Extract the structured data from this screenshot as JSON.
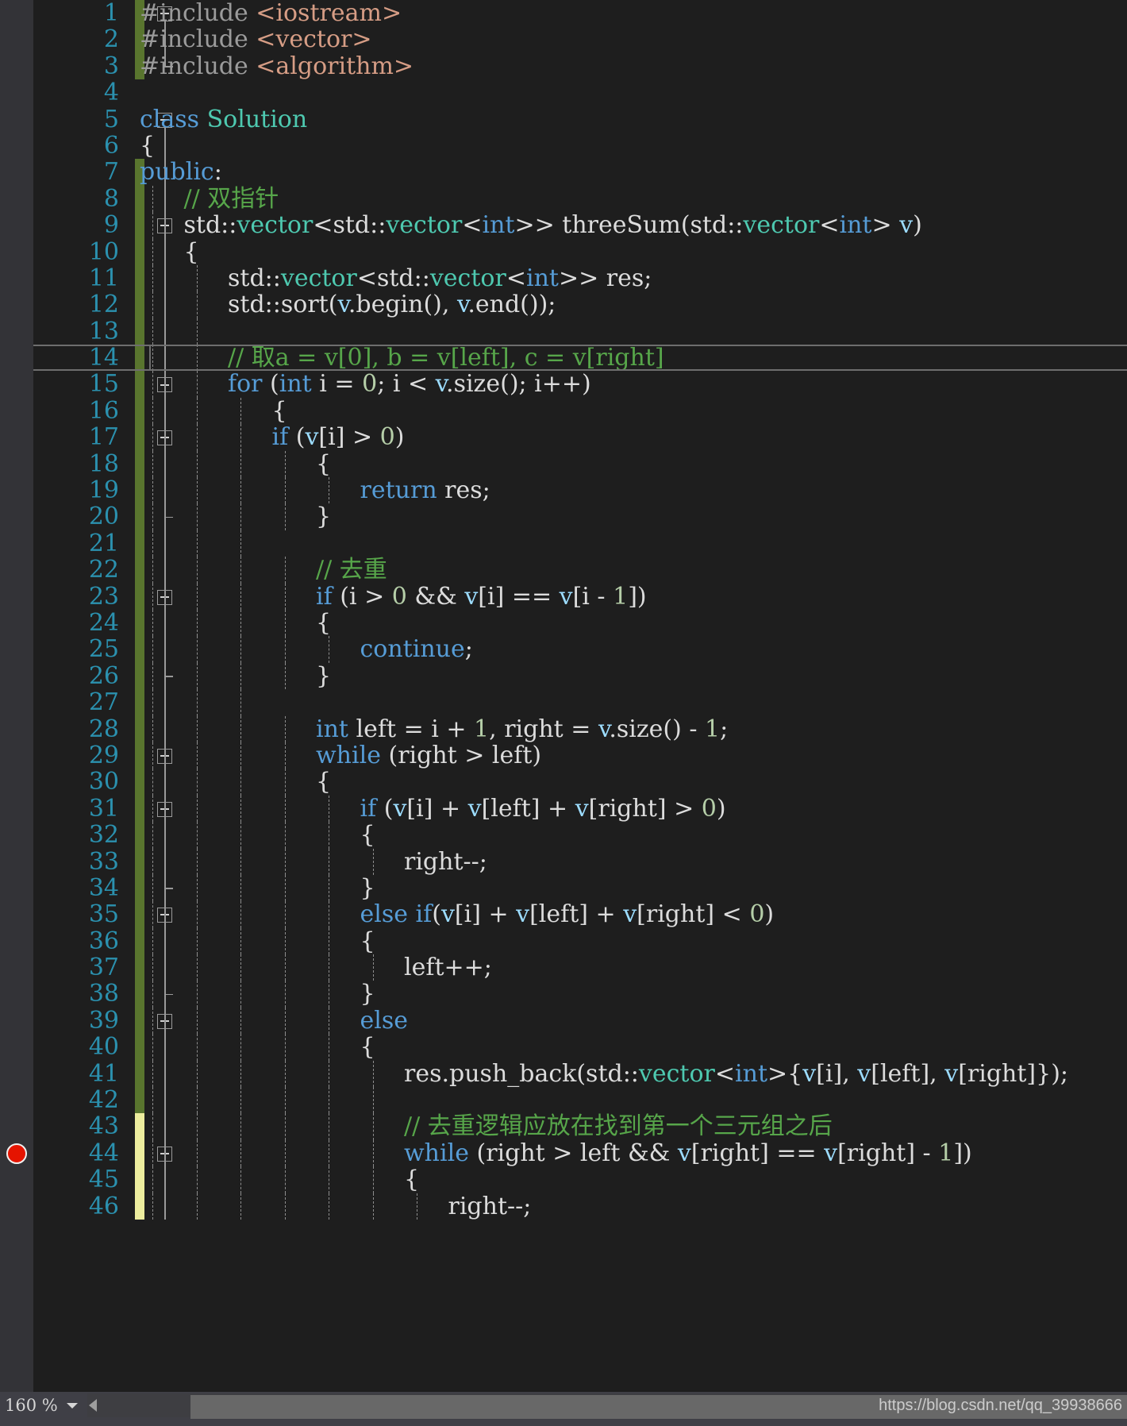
{
  "editor": {
    "language": "cpp",
    "theme": "visual-studio-dark",
    "breakpoint_line": 44,
    "current_line": 14,
    "first_visible_line": 1,
    "last_visible_line": 46,
    "colors": {
      "background": "#1e1e1e",
      "gutter": "#333337",
      "line_number": "#2b91af",
      "keyword": "#569cd6",
      "type": "#4ec9b0",
      "comment": "#57a64a",
      "string": "#d69d85",
      "number": "#b5cea8",
      "local_variable": "#9cdcfe",
      "plain_text": "#dcdcdc",
      "change_bar_saved": "#59752e",
      "change_bar_unsaved": "#eded9e",
      "breakpoint": "#e51400",
      "status_bar": "#3f3f46"
    },
    "lines": [
      {
        "n": 1,
        "change": "green",
        "fold": "start",
        "guides": 0,
        "indent": 0,
        "tokens": [
          {
            "t": "#include ",
            "c": "t-pre"
          },
          {
            "t": "<iostream>",
            "c": "t-str"
          }
        ]
      },
      {
        "n": 2,
        "change": "green",
        "fold": "line",
        "guides": 0,
        "indent": 0,
        "tokens": [
          {
            "t": "#include ",
            "c": "t-pre"
          },
          {
            "t": "<vector>",
            "c": "t-str"
          }
        ]
      },
      {
        "n": 3,
        "change": "green",
        "fold": "end",
        "guides": 0,
        "indent": 0,
        "tokens": [
          {
            "t": "#include ",
            "c": "t-pre"
          },
          {
            "t": "<algorithm>",
            "c": "t-str"
          }
        ]
      },
      {
        "n": 4,
        "change": "none",
        "fold": "none",
        "guides": 0,
        "indent": 0,
        "tokens": []
      },
      {
        "n": 5,
        "change": "none",
        "fold": "start",
        "guides": 0,
        "indent": 0,
        "tokens": [
          {
            "t": "class ",
            "c": "t-kw"
          },
          {
            "t": "Solution",
            "c": "t-type"
          }
        ]
      },
      {
        "n": 6,
        "change": "none",
        "fold": "line",
        "guides": 0,
        "indent": 0,
        "tokens": [
          {
            "t": "{",
            "c": "t-punct"
          }
        ]
      },
      {
        "n": 7,
        "change": "green",
        "fold": "line",
        "guides": 0,
        "indent": 0,
        "tokens": [
          {
            "t": "public",
            "c": "t-kw"
          },
          {
            "t": ":",
            "c": "t-punct"
          }
        ]
      },
      {
        "n": 8,
        "change": "green",
        "fold": "line",
        "guides": 1,
        "indent": 1,
        "tokens": [
          {
            "t": "// 双指针",
            "c": "t-cmt"
          }
        ]
      },
      {
        "n": 9,
        "change": "green",
        "fold": "start2",
        "guides": 1,
        "indent": 1,
        "tokens": [
          {
            "t": "std",
            "c": "t-plain"
          },
          {
            "t": "::",
            "c": "t-punct"
          },
          {
            "t": "vector",
            "c": "t-type"
          },
          {
            "t": "<",
            "c": "t-punct"
          },
          {
            "t": "std",
            "c": "t-plain"
          },
          {
            "t": "::",
            "c": "t-punct"
          },
          {
            "t": "vector",
            "c": "t-type"
          },
          {
            "t": "<",
            "c": "t-punct"
          },
          {
            "t": "int",
            "c": "t-kw"
          },
          {
            "t": ">> ",
            "c": "t-punct"
          },
          {
            "t": "threeSum",
            "c": "t-plain"
          },
          {
            "t": "(",
            "c": "t-punct"
          },
          {
            "t": "std",
            "c": "t-plain"
          },
          {
            "t": "::",
            "c": "t-punct"
          },
          {
            "t": "vector",
            "c": "t-type"
          },
          {
            "t": "<",
            "c": "t-punct"
          },
          {
            "t": "int",
            "c": "t-kw"
          },
          {
            "t": "> ",
            "c": "t-punct"
          },
          {
            "t": "v",
            "c": "t-var"
          },
          {
            "t": ")",
            "c": "t-punct"
          }
        ]
      },
      {
        "n": 10,
        "change": "green",
        "fold": "line2",
        "guides": 1,
        "indent": 1,
        "tokens": [
          {
            "t": "{",
            "c": "t-punct"
          }
        ]
      },
      {
        "n": 11,
        "change": "green",
        "fold": "line2",
        "guides": 2,
        "indent": 2,
        "tokens": [
          {
            "t": "std",
            "c": "t-plain"
          },
          {
            "t": "::",
            "c": "t-punct"
          },
          {
            "t": "vector",
            "c": "t-type"
          },
          {
            "t": "<",
            "c": "t-punct"
          },
          {
            "t": "std",
            "c": "t-plain"
          },
          {
            "t": "::",
            "c": "t-punct"
          },
          {
            "t": "vector",
            "c": "t-type"
          },
          {
            "t": "<",
            "c": "t-punct"
          },
          {
            "t": "int",
            "c": "t-kw"
          },
          {
            "t": ">> ",
            "c": "t-punct"
          },
          {
            "t": "res",
            "c": "t-plain"
          },
          {
            "t": ";",
            "c": "t-punct"
          }
        ]
      },
      {
        "n": 12,
        "change": "green",
        "fold": "line2",
        "guides": 2,
        "indent": 2,
        "tokens": [
          {
            "t": "std",
            "c": "t-plain"
          },
          {
            "t": "::",
            "c": "t-punct"
          },
          {
            "t": "sort",
            "c": "t-plain"
          },
          {
            "t": "(",
            "c": "t-punct"
          },
          {
            "t": "v",
            "c": "t-var"
          },
          {
            "t": ".begin(), ",
            "c": "t-plain"
          },
          {
            "t": "v",
            "c": "t-var"
          },
          {
            "t": ".end());",
            "c": "t-plain"
          }
        ]
      },
      {
        "n": 13,
        "change": "green",
        "fold": "line2",
        "guides": 2,
        "indent": 2,
        "tokens": []
      },
      {
        "n": 14,
        "change": "green",
        "fold": "line2",
        "guides": 2,
        "indent": 2,
        "tokens": [
          {
            "t": "// 取a = v[0], b = v[left], c = v[right]",
            "c": "t-cmt"
          }
        ]
      },
      {
        "n": 15,
        "change": "green",
        "fold": "start3",
        "guides": 2,
        "indent": 2,
        "tokens": [
          {
            "t": "for ",
            "c": "t-kw"
          },
          {
            "t": "(",
            "c": "t-punct"
          },
          {
            "t": "int",
            "c": "t-kw"
          },
          {
            "t": " i = ",
            "c": "t-plain"
          },
          {
            "t": "0",
            "c": "t-num"
          },
          {
            "t": "; i < ",
            "c": "t-plain"
          },
          {
            "t": "v",
            "c": "t-var"
          },
          {
            "t": ".size(); i++)",
            "c": "t-plain"
          }
        ]
      },
      {
        "n": 16,
        "change": "green",
        "fold": "line3",
        "guides": 3,
        "indent": 3,
        "tokens": [
          {
            "t": "{",
            "c": "t-punct"
          }
        ]
      },
      {
        "n": 17,
        "change": "green",
        "fold": "start4",
        "guides": 3,
        "indent": 3,
        "tokens": [
          {
            "t": "if ",
            "c": "t-kw"
          },
          {
            "t": "(",
            "c": "t-punct"
          },
          {
            "t": "v",
            "c": "t-var"
          },
          {
            "t": "[i] > ",
            "c": "t-plain"
          },
          {
            "t": "0",
            "c": "t-num"
          },
          {
            "t": ")",
            "c": "t-punct"
          }
        ]
      },
      {
        "n": 18,
        "change": "green",
        "fold": "line4",
        "guides": 4,
        "indent": 4,
        "tokens": [
          {
            "t": "{",
            "c": "t-punct"
          }
        ]
      },
      {
        "n": 19,
        "change": "green",
        "fold": "line4",
        "guides": 5,
        "indent": 5,
        "tokens": [
          {
            "t": "return ",
            "c": "t-kw"
          },
          {
            "t": "res;",
            "c": "t-plain"
          }
        ]
      },
      {
        "n": 20,
        "change": "green",
        "fold": "endin4",
        "guides": 4,
        "indent": 4,
        "tokens": [
          {
            "t": "}",
            "c": "t-punct"
          }
        ]
      },
      {
        "n": 21,
        "change": "green",
        "fold": "line3",
        "guides": 3,
        "indent": 3,
        "tokens": []
      },
      {
        "n": 22,
        "change": "green",
        "fold": "line3",
        "guides": 4,
        "indent": 4,
        "tokens": [
          {
            "t": "// 去重",
            "c": "t-cmt"
          }
        ]
      },
      {
        "n": 23,
        "change": "green",
        "fold": "start4",
        "guides": 4,
        "indent": 4,
        "tokens": [
          {
            "t": "if ",
            "c": "t-kw"
          },
          {
            "t": "(i > ",
            "c": "t-plain"
          },
          {
            "t": "0",
            "c": "t-num"
          },
          {
            "t": " && ",
            "c": "t-plain"
          },
          {
            "t": "v",
            "c": "t-var"
          },
          {
            "t": "[i] == ",
            "c": "t-plain"
          },
          {
            "t": "v",
            "c": "t-var"
          },
          {
            "t": "[i - ",
            "c": "t-plain"
          },
          {
            "t": "1",
            "c": "t-num"
          },
          {
            "t": "])",
            "c": "t-plain"
          }
        ]
      },
      {
        "n": 24,
        "change": "green",
        "fold": "line4",
        "guides": 4,
        "indent": 4,
        "tokens": [
          {
            "t": "{",
            "c": "t-punct"
          }
        ]
      },
      {
        "n": 25,
        "change": "green",
        "fold": "line4",
        "guides": 5,
        "indent": 5,
        "tokens": [
          {
            "t": "continue",
            "c": "t-kw"
          },
          {
            "t": ";",
            "c": "t-punct"
          }
        ]
      },
      {
        "n": 26,
        "change": "green",
        "fold": "endin4",
        "guides": 4,
        "indent": 4,
        "tokens": [
          {
            "t": "}",
            "c": "t-punct"
          }
        ]
      },
      {
        "n": 27,
        "change": "green",
        "fold": "line3",
        "guides": 3,
        "indent": 3,
        "tokens": []
      },
      {
        "n": 28,
        "change": "green",
        "fold": "line3",
        "guides": 4,
        "indent": 4,
        "tokens": [
          {
            "t": "int",
            "c": "t-kw"
          },
          {
            "t": " left = i + ",
            "c": "t-plain"
          },
          {
            "t": "1",
            "c": "t-num"
          },
          {
            "t": ", right = ",
            "c": "t-plain"
          },
          {
            "t": "v",
            "c": "t-var"
          },
          {
            "t": ".size() - ",
            "c": "t-plain"
          },
          {
            "t": "1",
            "c": "t-num"
          },
          {
            "t": ";",
            "c": "t-punct"
          }
        ]
      },
      {
        "n": 29,
        "change": "green",
        "fold": "start4",
        "guides": 4,
        "indent": 4,
        "tokens": [
          {
            "t": "while ",
            "c": "t-kw"
          },
          {
            "t": "(right > left)",
            "c": "t-plain"
          }
        ]
      },
      {
        "n": 30,
        "change": "green",
        "fold": "line4",
        "guides": 4,
        "indent": 4,
        "tokens": [
          {
            "t": "{",
            "c": "t-punct"
          }
        ]
      },
      {
        "n": 31,
        "change": "green",
        "fold": "start5",
        "guides": 5,
        "indent": 5,
        "tokens": [
          {
            "t": "if ",
            "c": "t-kw"
          },
          {
            "t": "(",
            "c": "t-punct"
          },
          {
            "t": "v",
            "c": "t-var"
          },
          {
            "t": "[i] + ",
            "c": "t-plain"
          },
          {
            "t": "v",
            "c": "t-var"
          },
          {
            "t": "[left] + ",
            "c": "t-plain"
          },
          {
            "t": "v",
            "c": "t-var"
          },
          {
            "t": "[right] > ",
            "c": "t-plain"
          },
          {
            "t": "0",
            "c": "t-num"
          },
          {
            "t": ")",
            "c": "t-punct"
          }
        ]
      },
      {
        "n": 32,
        "change": "green",
        "fold": "line5",
        "guides": 5,
        "indent": 5,
        "tokens": [
          {
            "t": "{",
            "c": "t-punct"
          }
        ]
      },
      {
        "n": 33,
        "change": "green",
        "fold": "line5",
        "guides": 6,
        "indent": 6,
        "tokens": [
          {
            "t": "right--;",
            "c": "t-plain"
          }
        ]
      },
      {
        "n": 34,
        "change": "green",
        "fold": "endin5",
        "guides": 5,
        "indent": 5,
        "tokens": [
          {
            "t": "}",
            "c": "t-punct"
          }
        ]
      },
      {
        "n": 35,
        "change": "green",
        "fold": "start5",
        "guides": 5,
        "indent": 5,
        "tokens": [
          {
            "t": "else ",
            "c": "t-kw"
          },
          {
            "t": "if",
            "c": "t-kw"
          },
          {
            "t": "(",
            "c": "t-punct"
          },
          {
            "t": "v",
            "c": "t-var"
          },
          {
            "t": "[i] + ",
            "c": "t-plain"
          },
          {
            "t": "v",
            "c": "t-var"
          },
          {
            "t": "[left] + ",
            "c": "t-plain"
          },
          {
            "t": "v",
            "c": "t-var"
          },
          {
            "t": "[right] < ",
            "c": "t-plain"
          },
          {
            "t": "0",
            "c": "t-num"
          },
          {
            "t": ")",
            "c": "t-punct"
          }
        ]
      },
      {
        "n": 36,
        "change": "green",
        "fold": "line5",
        "guides": 5,
        "indent": 5,
        "tokens": [
          {
            "t": "{",
            "c": "t-punct"
          }
        ]
      },
      {
        "n": 37,
        "change": "green",
        "fold": "line5",
        "guides": 6,
        "indent": 6,
        "tokens": [
          {
            "t": "left++;",
            "c": "t-plain"
          }
        ]
      },
      {
        "n": 38,
        "change": "green",
        "fold": "endin5",
        "guides": 5,
        "indent": 5,
        "tokens": [
          {
            "t": "}",
            "c": "t-punct"
          }
        ]
      },
      {
        "n": 39,
        "change": "green",
        "fold": "start5",
        "guides": 5,
        "indent": 5,
        "tokens": [
          {
            "t": "else",
            "c": "t-kw"
          }
        ]
      },
      {
        "n": 40,
        "change": "green",
        "fold": "line5",
        "guides": 5,
        "indent": 5,
        "tokens": [
          {
            "t": "{",
            "c": "t-punct"
          }
        ]
      },
      {
        "n": 41,
        "change": "green",
        "fold": "line5",
        "guides": 6,
        "indent": 6,
        "tokens": [
          {
            "t": "res.push_back(",
            "c": "t-plain"
          },
          {
            "t": "std",
            "c": "t-plain"
          },
          {
            "t": "::",
            "c": "t-punct"
          },
          {
            "t": "vector",
            "c": "t-type"
          },
          {
            "t": "<",
            "c": "t-punct"
          },
          {
            "t": "int",
            "c": "t-kw"
          },
          {
            "t": ">{",
            "c": "t-punct"
          },
          {
            "t": "v",
            "c": "t-var"
          },
          {
            "t": "[i], ",
            "c": "t-plain"
          },
          {
            "t": "v",
            "c": "t-var"
          },
          {
            "t": "[left], ",
            "c": "t-plain"
          },
          {
            "t": "v",
            "c": "t-var"
          },
          {
            "t": "[right]});",
            "c": "t-plain"
          }
        ]
      },
      {
        "n": 42,
        "change": "green",
        "fold": "line5",
        "guides": 6,
        "indent": 6,
        "tokens": []
      },
      {
        "n": 43,
        "change": "yellow",
        "fold": "line5",
        "guides": 6,
        "indent": 6,
        "tokens": [
          {
            "t": "// 去重逻辑应放在找到第一个三元组之后",
            "c": "t-cmt"
          }
        ]
      },
      {
        "n": 44,
        "change": "yellow",
        "fold": "start6",
        "guides": 6,
        "indent": 6,
        "tokens": [
          {
            "t": "while ",
            "c": "t-kw"
          },
          {
            "t": "(right > left && ",
            "c": "t-plain"
          },
          {
            "t": "v",
            "c": "t-var"
          },
          {
            "t": "[right] == ",
            "c": "t-plain"
          },
          {
            "t": "v",
            "c": "t-var"
          },
          {
            "t": "[right] - ",
            "c": "t-plain"
          },
          {
            "t": "1",
            "c": "t-num"
          },
          {
            "t": "])",
            "c": "t-plain"
          }
        ]
      },
      {
        "n": 45,
        "change": "yellow",
        "fold": "line6",
        "guides": 6,
        "indent": 6,
        "tokens": [
          {
            "t": "{",
            "c": "t-punct"
          }
        ]
      },
      {
        "n": 46,
        "change": "yellow",
        "fold": "line6",
        "guides": 7,
        "indent": 7,
        "tokens": [
          {
            "t": "right--;",
            "c": "t-plain"
          }
        ]
      }
    ]
  },
  "status_bar": {
    "zoom_level": "160 %",
    "zoom_dropdown_icon": "chevron-down-icon",
    "scroll_left_icon": "triangle-left-icon",
    "watermark": "https://blog.csdn.net/qq_39938666"
  }
}
